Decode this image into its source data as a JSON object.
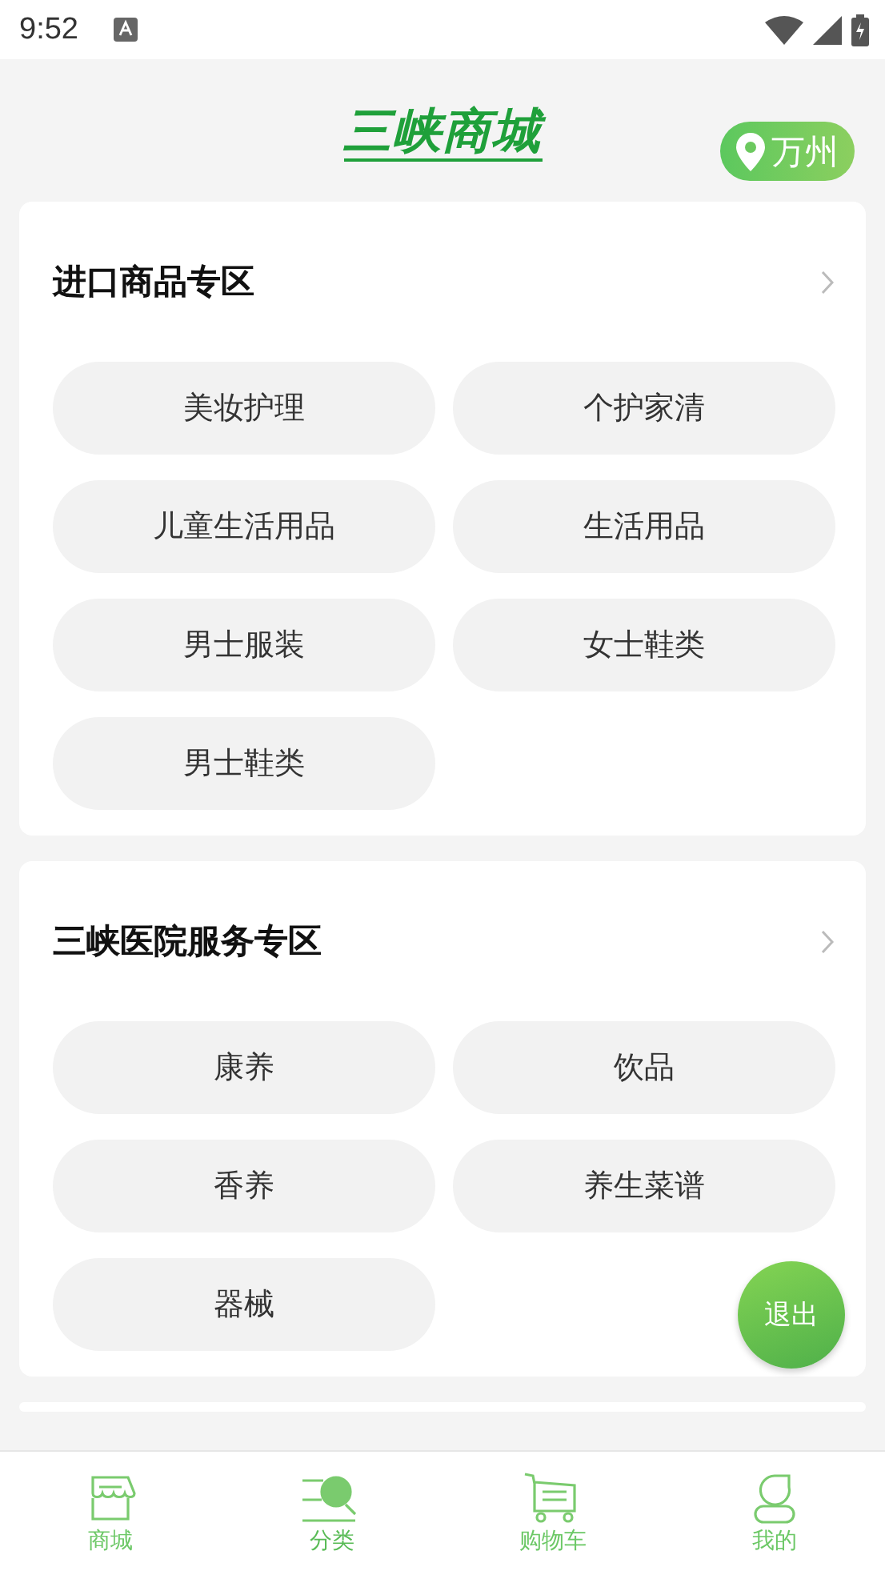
{
  "status_bar": {
    "time": "9:52"
  },
  "header": {
    "logo": "三峡商城",
    "location": "万州"
  },
  "sections": [
    {
      "title": "进口商品专区",
      "items": [
        "美妆护理",
        "个护家清",
        "儿童生活用品",
        "生活用品",
        "男士服装",
        "女士鞋类",
        "男士鞋类"
      ]
    },
    {
      "title": "三峡医院服务专区",
      "items": [
        "康养",
        "饮品",
        "香养",
        "养生菜谱",
        "器械"
      ]
    }
  ],
  "floating_button": "退出",
  "tab_bar": [
    {
      "kind": "shop",
      "label": "商城",
      "selected": false
    },
    {
      "kind": "category",
      "label": "分类",
      "selected": true
    },
    {
      "kind": "cart",
      "label": "购物车",
      "selected": false
    },
    {
      "kind": "user",
      "label": "我的",
      "selected": false
    }
  ]
}
